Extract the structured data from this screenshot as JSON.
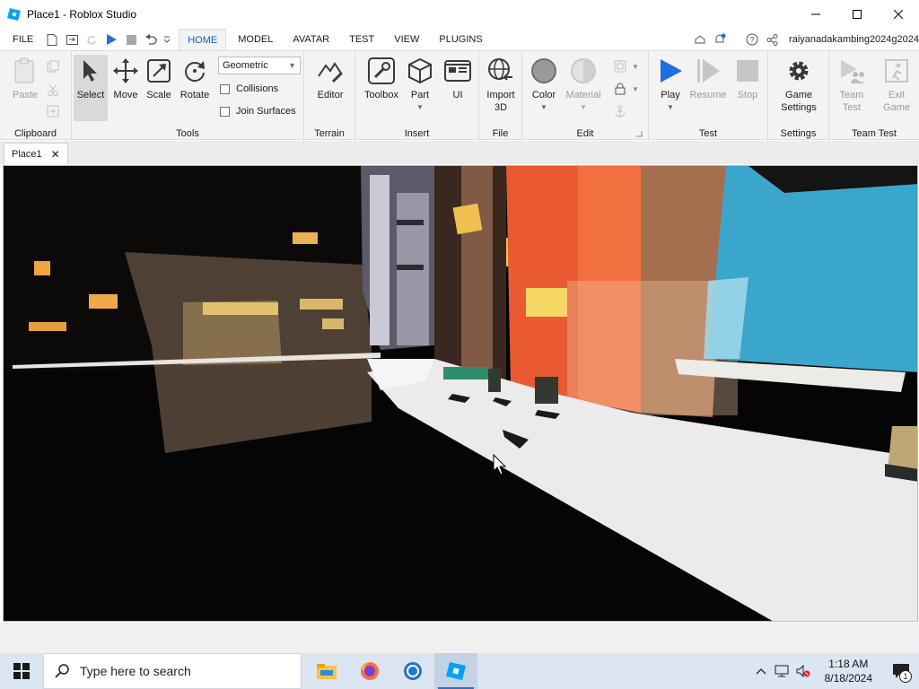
{
  "window": {
    "title": "Place1 - Roblox Studio"
  },
  "menu": {
    "file": "FILE",
    "tabs": [
      "HOME",
      "MODEL",
      "AVATAR",
      "TEST",
      "VIEW",
      "PLUGINS"
    ],
    "active_tab": "HOME",
    "username": "raiyanadakambing2024g2024"
  },
  "ribbon": {
    "clipboard": {
      "label": "Clipboard",
      "paste": "Paste"
    },
    "tools": {
      "label": "Tools",
      "select": "Select",
      "move": "Move",
      "scale": "Scale",
      "rotate": "Rotate",
      "mode": "Geometric",
      "collisions": "Collisions",
      "join_surfaces": "Join Surfaces"
    },
    "terrain": {
      "label": "Terrain",
      "editor": "Editor"
    },
    "insert": {
      "label": "Insert",
      "toolbox": "Toolbox",
      "part": "Part",
      "ui": "UI"
    },
    "file": {
      "label": "File",
      "import_3d_line1": "Import",
      "import_3d_line2": "3D"
    },
    "edit": {
      "label": "Edit",
      "color": "Color",
      "material": "Material"
    },
    "test": {
      "label": "Test",
      "play": "Play",
      "resume": "Resume",
      "stop": "Stop"
    },
    "settings": {
      "label": "Settings",
      "game_settings_line1": "Game",
      "game_settings_line2": "Settings"
    },
    "team_test": {
      "label": "Team Test",
      "team_test_line1": "Team",
      "team_test_line2": "Test",
      "exit_game_line1": "Exit",
      "exit_game_line2": "Game"
    }
  },
  "document_tab": {
    "label": "Place1"
  },
  "taskbar": {
    "search_placeholder": "Type here to search",
    "time": "1:18 AM",
    "date": "8/18/2024",
    "notification_count": "1"
  },
  "colors": {
    "accent": "#0a64c8",
    "play": "#1e6fe0",
    "taskbar": "#dbe6f2"
  }
}
